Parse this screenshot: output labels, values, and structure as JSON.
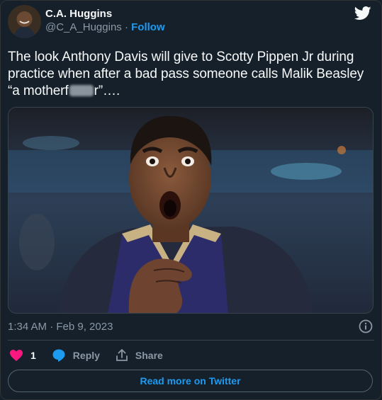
{
  "author": {
    "name": "C.A. Huggins",
    "handle": "@C_A_Huggins",
    "separator": "·",
    "follow_label": "Follow"
  },
  "tweet": {
    "text_part1": "The look Anthony Davis will give to Scotty Pippen Jr during practice when after a bad pass someone calls Malik Beasley “a motherf",
    "text_part2": "r”….",
    "timestamp": "1:34 AM · Feb 9, 2023"
  },
  "actions": {
    "like_count": "1",
    "reply_label": "Reply",
    "share_label": "Share"
  },
  "footer": {
    "read_more_label": "Read more on Twitter"
  },
  "colors": {
    "background": "#15202b",
    "accent": "#1d9bf0",
    "like": "#f91880"
  },
  "icons": [
    "twitter-bird-icon",
    "info-icon",
    "heart-icon",
    "reply-bubble-icon",
    "share-icon"
  ]
}
